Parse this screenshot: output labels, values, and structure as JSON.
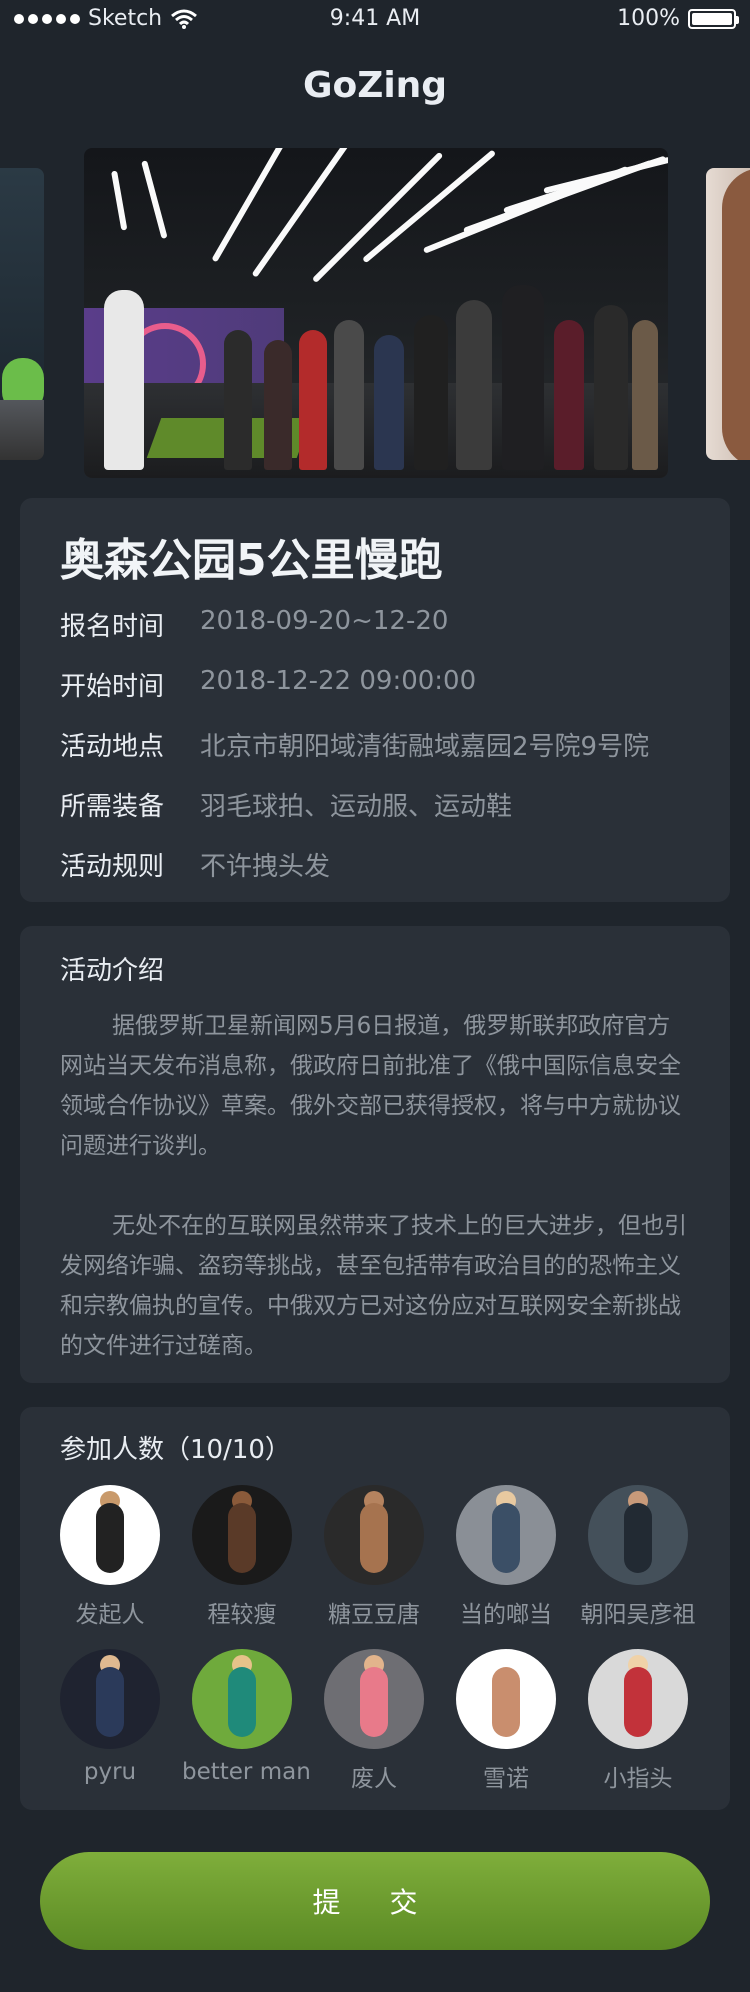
{
  "status": {
    "carrier": "Sketch",
    "time": "9:41 AM",
    "battery": "100%"
  },
  "header": {
    "title": "GoZing"
  },
  "event": {
    "title": "奥森公园5公里慢跑",
    "info": [
      {
        "label": "报名时间",
        "value": "2018-09-20~12-20"
      },
      {
        "label": "开始时间",
        "value": "2018-12-22 09:00:00"
      },
      {
        "label": "活动地点",
        "value": "北京市朝阳域清街融域嘉园2号院9号院"
      },
      {
        "label": "所需装备",
        "value": "羽毛球拍、运动服、运动鞋"
      },
      {
        "label": "活动规则",
        "value": "不许拽头发"
      }
    ]
  },
  "intro": {
    "title": "活动介绍",
    "paragraphs": [
      "据俄罗斯卫星新闻网5月6日报道，俄罗斯联邦政府官方网站当天发布消息称，俄政府日前批准了《俄中国际信息安全领域合作协议》草案。俄外交部已获得授权，将与中方就协议问题进行谈判。",
      "无处不在的互联网虽然带来了技术上的巨大进步，但也引发网络诈骗、盗窃等挑战，甚至包括带有政治目的的恐怖主义和宗教偏执的宣传。中俄双方已对这份应对互联网安全新挑战的文件进行过磋商。"
    ]
  },
  "members": {
    "title": "参加人数（10/10）",
    "list": [
      {
        "name": "发起人"
      },
      {
        "name": "程较瘦"
      },
      {
        "name": "糖豆豆唐"
      },
      {
        "name": "当的啷当"
      },
      {
        "name": "朝阳吴彦祖"
      },
      {
        "name": "pyru"
      },
      {
        "name": "better man"
      },
      {
        "name": "废人"
      },
      {
        "name": "雪诺"
      },
      {
        "name": "小指头"
      }
    ]
  },
  "submit": {
    "label": "提 交"
  }
}
